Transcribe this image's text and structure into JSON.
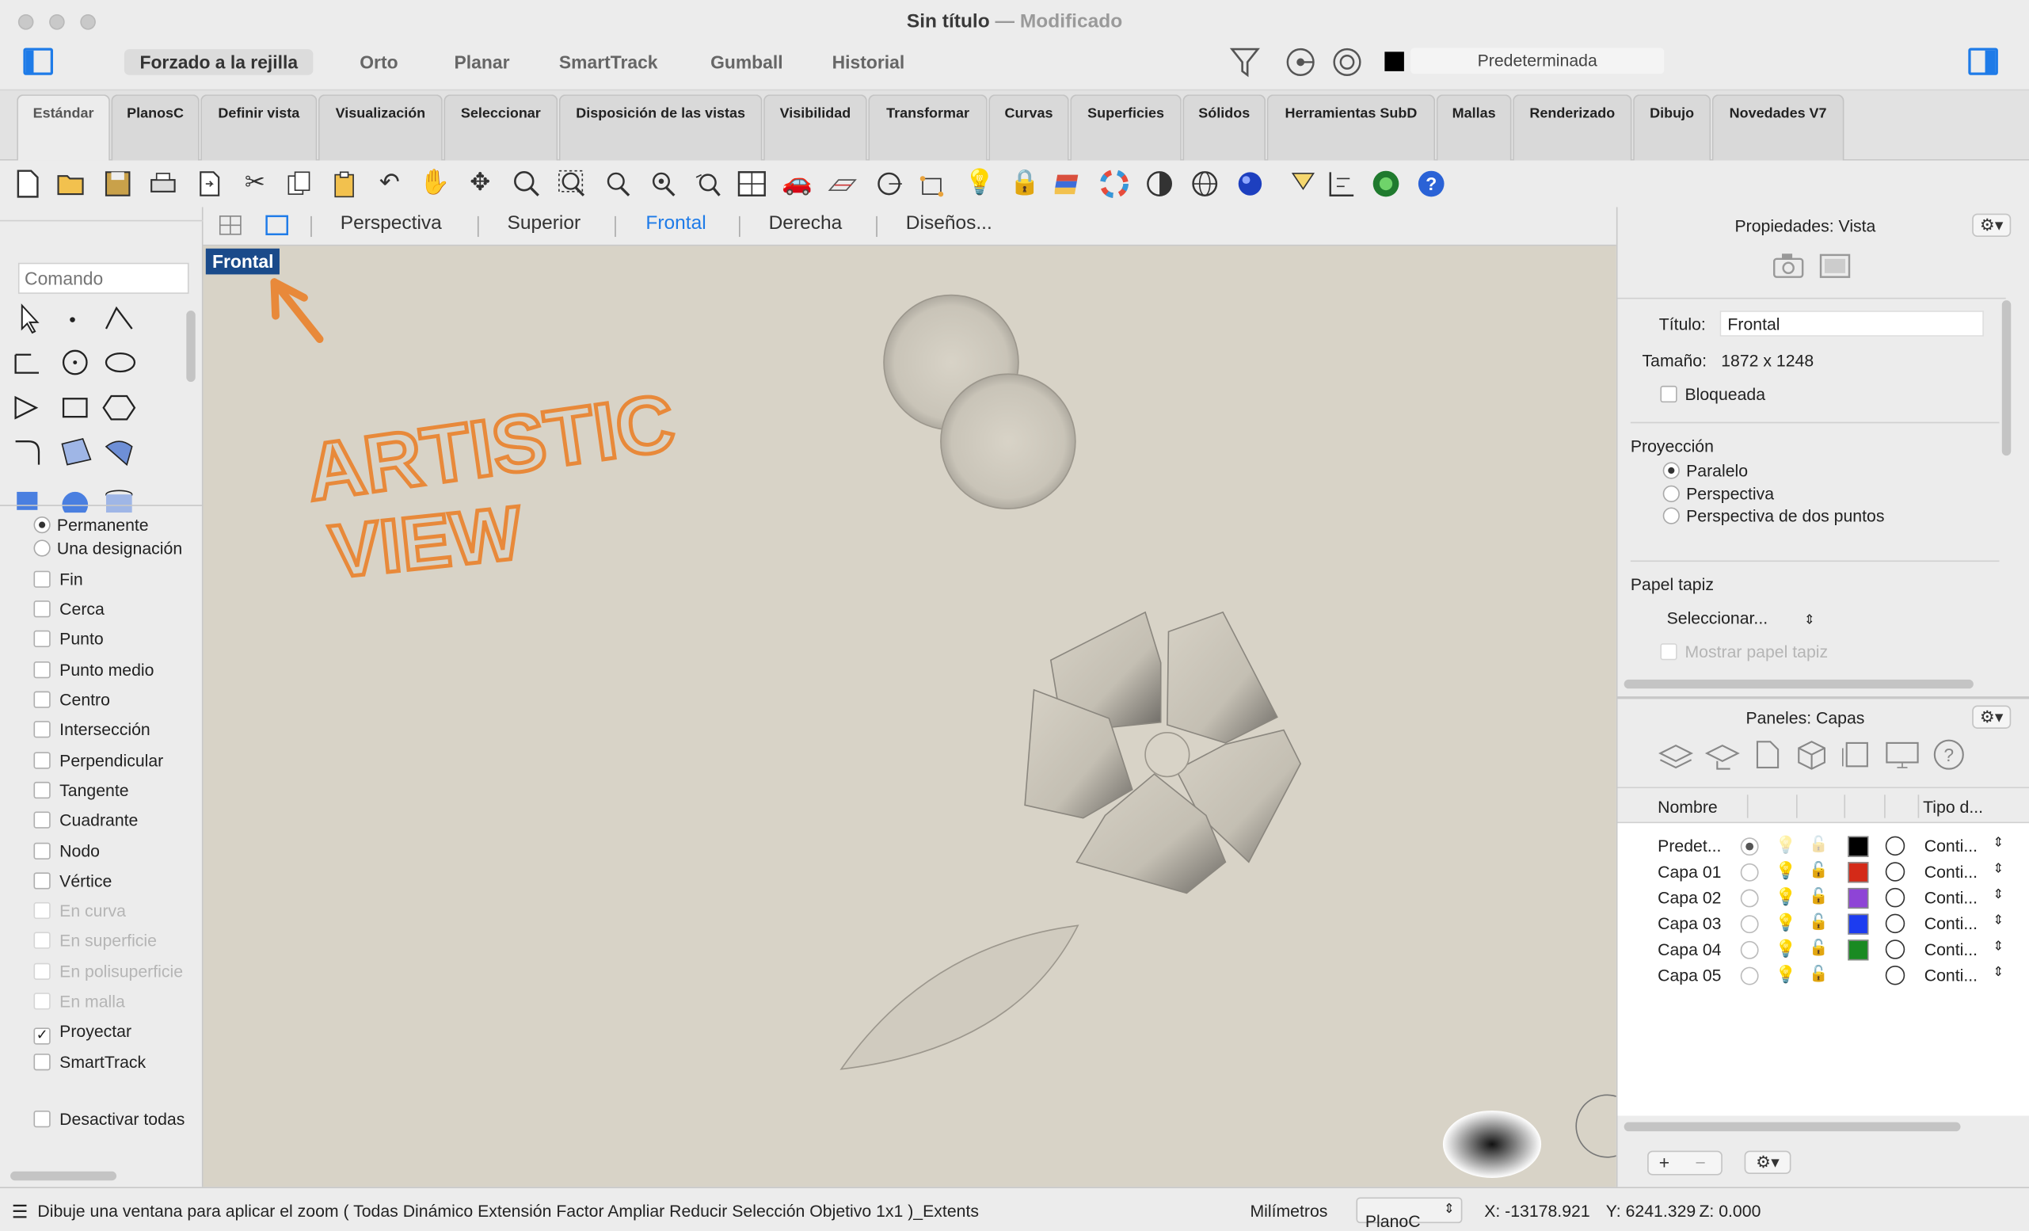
{
  "window": {
    "title": "Sin título",
    "separator": "—",
    "modified": "Modificado"
  },
  "snapbar": {
    "items": [
      "Forzado a la rejilla",
      "Orto",
      "Planar",
      "SmartTrack",
      "Gumball",
      "Historial"
    ],
    "layer_name": "Predeterminada"
  },
  "tabs": [
    "Estándar",
    "PlanosC",
    "Definir vista",
    "Visualización",
    "Seleccionar",
    "Disposición de las vistas",
    "Visibilidad",
    "Transformar",
    "Curvas",
    "Superficies",
    "Sólidos",
    "Herramientas SubD",
    "Mallas",
    "Renderizado",
    "Dibujo",
    "Novedades V7"
  ],
  "command": {
    "placeholder": "Comando"
  },
  "osnap": {
    "permanent": "Permanente",
    "once": "Una designación",
    "items": [
      "Fin",
      "Cerca",
      "Punto",
      "Punto medio",
      "Centro",
      "Intersección",
      "Perpendicular",
      "Tangente",
      "Cuadrante",
      "Nodo",
      "Vértice"
    ],
    "disabled_items": [
      "En curva",
      "En superficie",
      "En polisuperficie",
      "En malla"
    ],
    "project": "Proyectar",
    "smarttrack": "SmartTrack",
    "disable_all": "Desactivar todas",
    "project_checkmark": "✓"
  },
  "viewport": {
    "tabs": [
      "Perspectiva",
      "Superior",
      "Frontal",
      "Derecha",
      "Diseños..."
    ],
    "active_tab": "Frontal",
    "label": "Frontal",
    "sketch_text": [
      "ARTISTIC",
      "VIEW"
    ],
    "accent_color": "#1e7be8",
    "sketch_color": "#e8893a"
  },
  "properties": {
    "title": "Propiedades: Vista",
    "titulo_label": "Título:",
    "titulo_value": "Frontal",
    "size_label": "Tamaño:",
    "size_value": "1872 x 1248",
    "locked": "Bloqueada",
    "projection_label": "Proyección",
    "projection_options": [
      "Paralelo",
      "Perspectiva",
      "Perspectiva de dos puntos"
    ],
    "wallpaper_label": "Papel tapiz",
    "wallpaper_select": "Seleccionar...",
    "show_wallpaper": "Mostrar papel tapiz"
  },
  "layers": {
    "title": "Paneles: Capas",
    "col_name": "Nombre",
    "col_type": "Tipo d...",
    "rows": [
      {
        "name": "Predet...",
        "color": "#000000",
        "linetype": "Conti..."
      },
      {
        "name": "Capa 01",
        "color": "#d42a18",
        "linetype": "Conti..."
      },
      {
        "name": "Capa 02",
        "color": "#8e44d6",
        "linetype": "Conti..."
      },
      {
        "name": "Capa 03",
        "color": "#1c3cf0",
        "linetype": "Conti..."
      },
      {
        "name": "Capa 04",
        "color": "#1a8a22",
        "linetype": "Conti..."
      },
      {
        "name": "Capa 05",
        "color": "",
        "linetype": "Conti..."
      }
    ],
    "add": "+",
    "remove": "−"
  },
  "status": {
    "prompt": "Dibuje una ventana para aplicar el zoom ( Todas Dinámico Extensión Factor Ampliar Reducir Selección Objetivo 1x1 )_Extents",
    "units": "Milímetros",
    "cplane": "PlanoC",
    "x": "X: -13178.921",
    "y": "Y: 6241.329",
    "z": "Z: 0.000"
  }
}
